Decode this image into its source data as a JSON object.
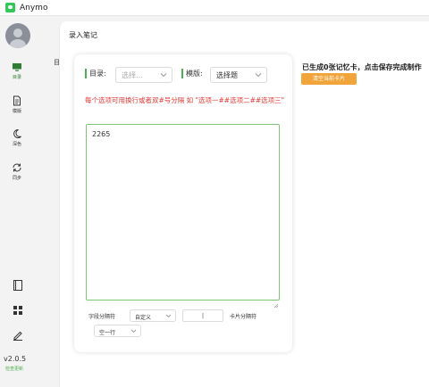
{
  "app": {
    "title": "Anymo"
  },
  "sidebar": {
    "items": [
      {
        "label": "目录",
        "icon": "monitor-icon"
      },
      {
        "label": "模版",
        "icon": "document-icon"
      },
      {
        "label": "深色",
        "icon": "moon-icon"
      },
      {
        "label": "同步",
        "icon": "sync-icon"
      }
    ],
    "bottom_icons": [
      "book-icon",
      "grid-icon",
      "pen-icon"
    ],
    "version": "v2.0.5",
    "check_update": "检查更新"
  },
  "background": {
    "mark": "目"
  },
  "modal": {
    "title": "录入笔记",
    "directory_label": "目录:",
    "directory_placeholder": "选择...",
    "template_label": "模版:",
    "template_value": "选择题",
    "hint": "每个选项可用换行或者双#号分隔 如 \"选项一##选项二##选项三\"",
    "content": "2265",
    "field_separator_label": "字段分隔符",
    "field_separator_value": "自定义",
    "field_separator_input": "|",
    "card_separator_label": "卡片分隔符",
    "card_separator_value": "空一行"
  },
  "status": {
    "text": "已生成0张记忆卡，点击保存完成制作",
    "clear_button": "清空当前卡片"
  },
  "colors": {
    "accent": "#4caf50",
    "warning": "#e53935",
    "button": "#f0a43a"
  }
}
